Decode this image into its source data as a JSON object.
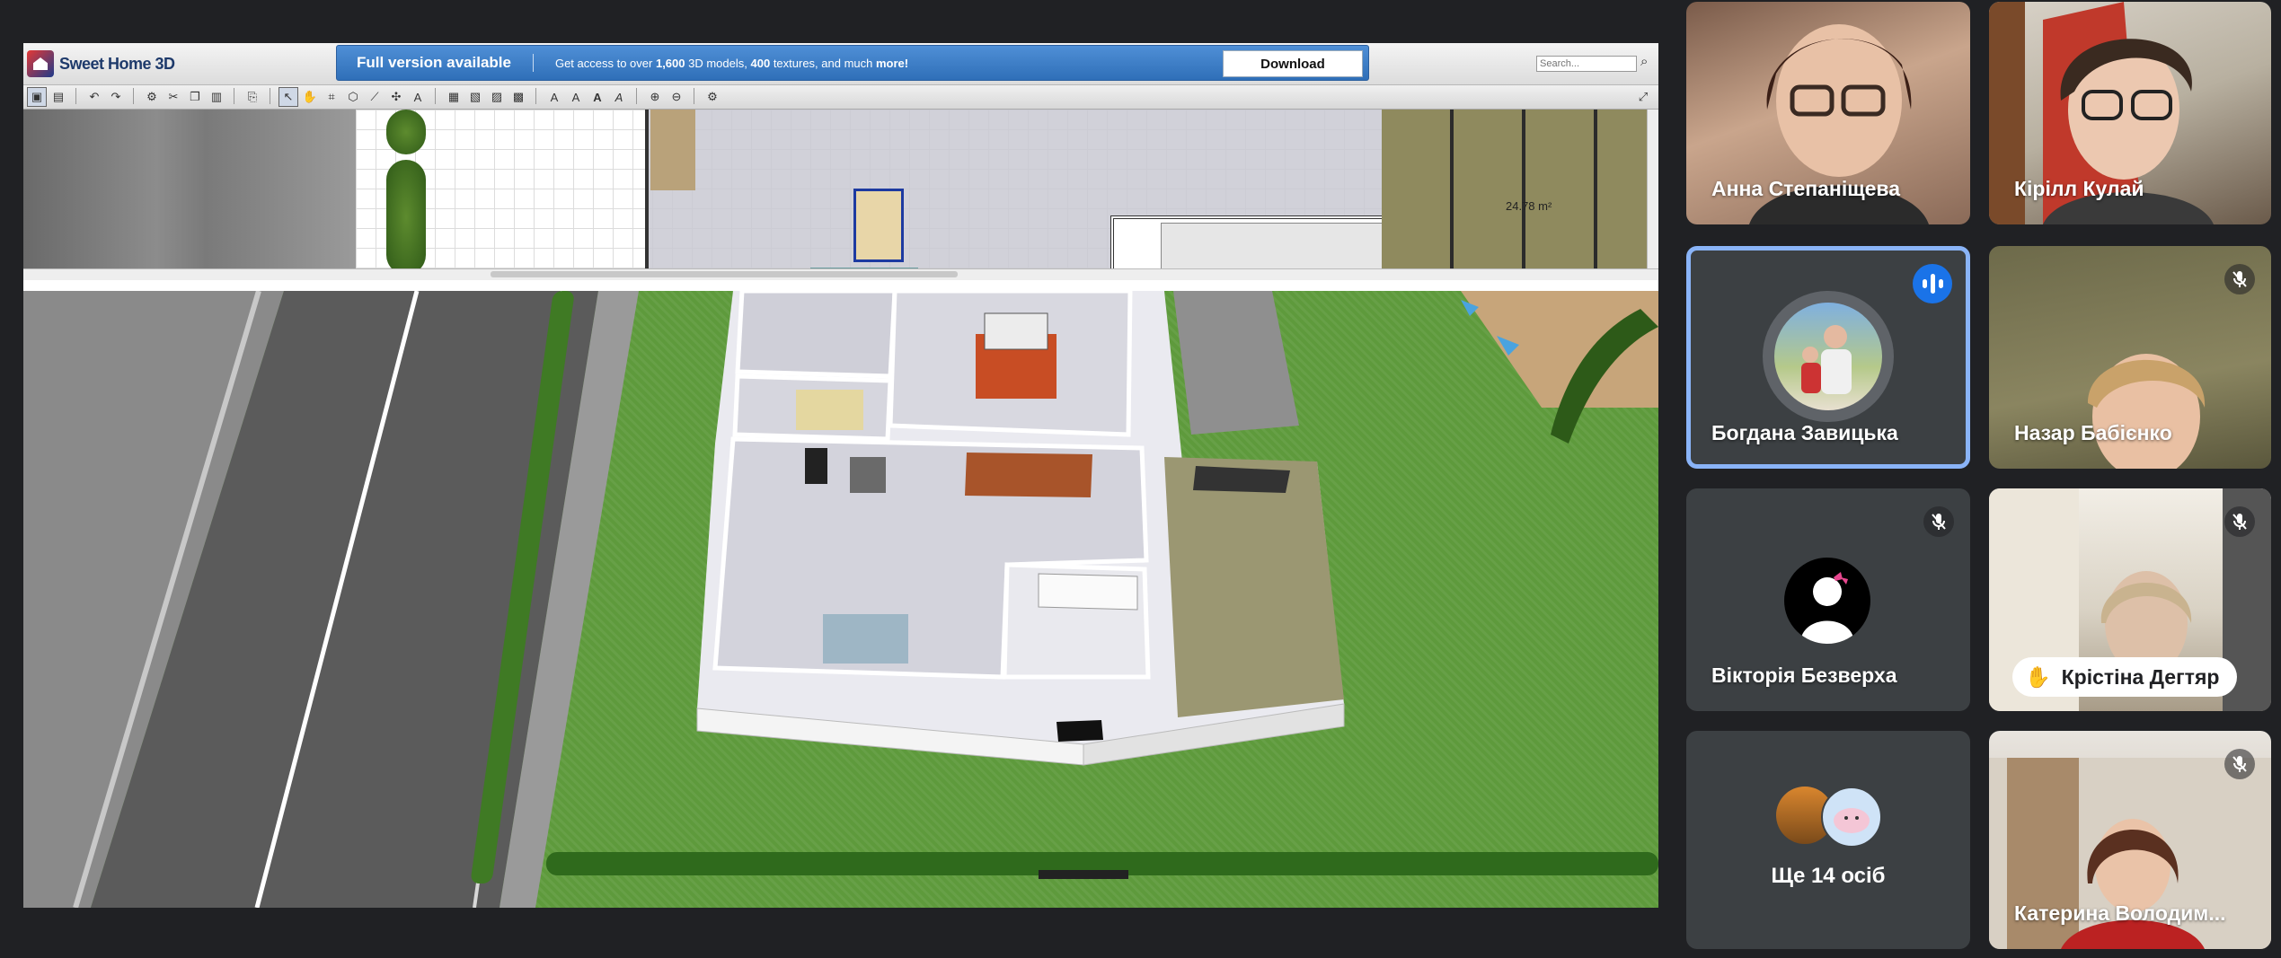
{
  "app": {
    "title": "Sweet Home 3D",
    "promo_title": "Full version available",
    "promo_text_prefix": "Get access to over ",
    "promo_models": "1,600",
    "promo_mid1": " 3D models, ",
    "promo_textures": "400",
    "promo_mid2": " textures, and much ",
    "promo_more": "more!",
    "download_label": "Download",
    "search_placeholder": "Search...",
    "plan_area_label": "24.78 m²"
  },
  "participants": [
    {
      "name": "Анна Степаніщева",
      "mic": "on"
    },
    {
      "name": "Кірілл Кулай",
      "mic": "on"
    },
    {
      "name": "Богдана Завицька",
      "mic": "speaking"
    },
    {
      "name": "Назар Бабієнко",
      "mic": "off"
    },
    {
      "name": "Вікторія Безверха",
      "mic": "off"
    },
    {
      "name": "Крістіна Дегтяр",
      "mic": "off",
      "hand_raised": true
    },
    {
      "name": "Катерина Володим...",
      "mic": "off"
    }
  ],
  "more_participants_label": "Ще 14 осіб",
  "colors": {
    "meet_bg": "#202124",
    "tile_bg": "#3c4043",
    "active_outline": "#8ab4f8",
    "speaking_blue": "#1a73e8",
    "promo_blue": "#2f6fb8",
    "grass": "#5e9a3c"
  },
  "icons": {
    "mic_off": "mic-off-icon",
    "speaking": "audio-level-icon",
    "hand": "raised-hand-icon",
    "search": "search-icon"
  }
}
